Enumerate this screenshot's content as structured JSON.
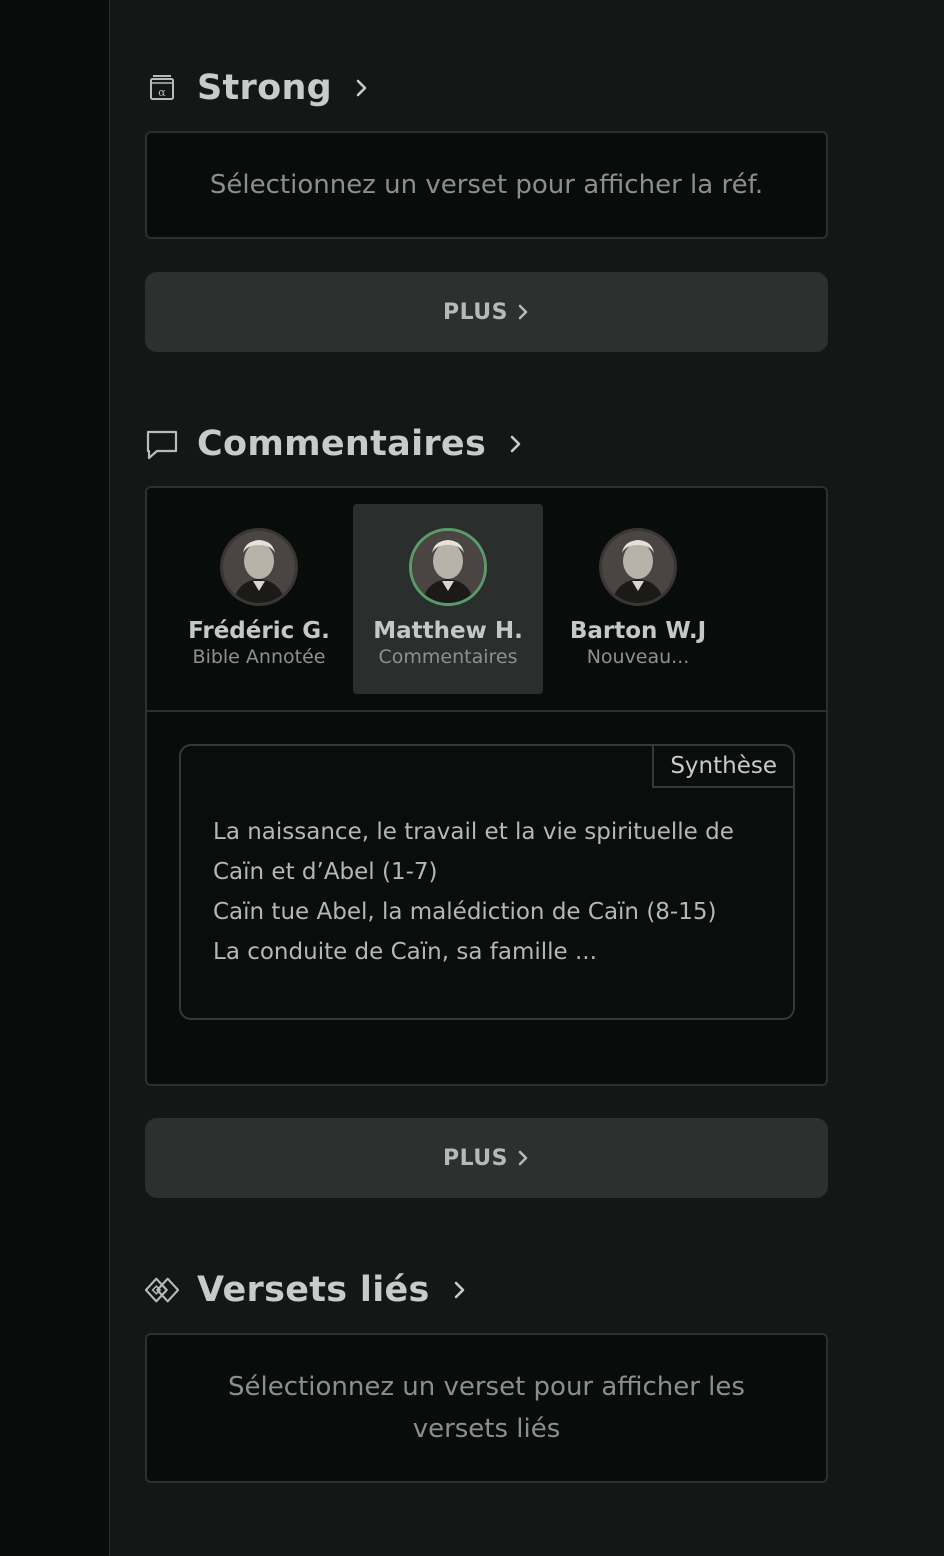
{
  "strong": {
    "title": "Strong",
    "empty_text": "Sélectionnez un verset pour afficher la réf.",
    "more_label": "PLUS"
  },
  "comments": {
    "title": "Commentaires",
    "authors": [
      {
        "name": "Frédéric G.",
        "subtitle": "Bible Annotée",
        "selected": false
      },
      {
        "name": "Matthew H.",
        "subtitle": "Commentaires",
        "selected": true
      },
      {
        "name": "Barton W.J",
        "subtitle": "Nouveau...",
        "selected": false
      }
    ],
    "synthesis_tag": "Synthèse",
    "synthesis_lines": [
      "La naissance, le travail et la vie spirituelle de Caïn et d’Abel (1-7)",
      "Caïn tue Abel, la malédiction de Caïn (8-15)",
      "La conduite de Caïn, sa famille ..."
    ],
    "more_label": "PLUS"
  },
  "related": {
    "title": "Versets liés",
    "empty_text": "Sélectionnez un verset pour afficher les versets liés"
  },
  "colors": {
    "background": "#141716",
    "card": "#080c0b",
    "button": "#2c302f",
    "selected_accent": "#5b9a6a"
  }
}
